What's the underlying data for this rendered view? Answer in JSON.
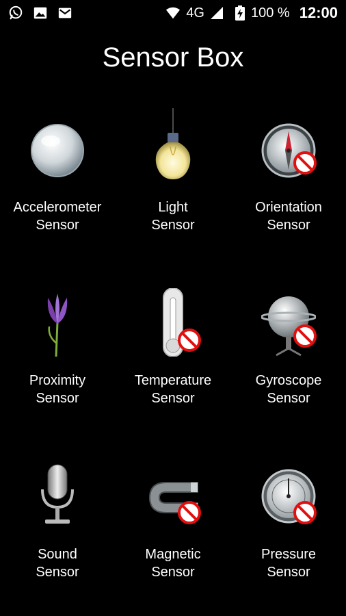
{
  "status_bar": {
    "left_icons": [
      "whatsapp-icon",
      "image-icon",
      "gmail-icon"
    ],
    "network": "4G",
    "battery": "100 %",
    "time": "12:00"
  },
  "title": "Sensor Box",
  "sensors": [
    {
      "line1": "Accelerometer",
      "line2": "Sensor",
      "icon": "crystal-ball-icon",
      "unavailable": false
    },
    {
      "line1": "Light",
      "line2": "Sensor",
      "icon": "light-bulb-icon",
      "unavailable": false
    },
    {
      "line1": "Orientation",
      "line2": "Sensor",
      "icon": "compass-icon",
      "unavailable": true
    },
    {
      "line1": "Proximity",
      "line2": "Sensor",
      "icon": "flower-icon",
      "unavailable": false
    },
    {
      "line1": "Temperature",
      "line2": "Sensor",
      "icon": "thermometer-icon",
      "unavailable": true
    },
    {
      "line1": "Gyroscope",
      "line2": "Sensor",
      "icon": "gyroscope-icon",
      "unavailable": true
    },
    {
      "line1": "Sound",
      "line2": "Sensor",
      "icon": "microphone-icon",
      "unavailable": false
    },
    {
      "line1": "Magnetic",
      "line2": "Sensor",
      "icon": "magnet-icon",
      "unavailable": true
    },
    {
      "line1": "Pressure",
      "line2": "Sensor",
      "icon": "pressure-gauge-icon",
      "unavailable": true
    }
  ],
  "colors": {
    "background": "#000000",
    "text": "#ffffff",
    "unavailable_badge": "#e01010"
  }
}
